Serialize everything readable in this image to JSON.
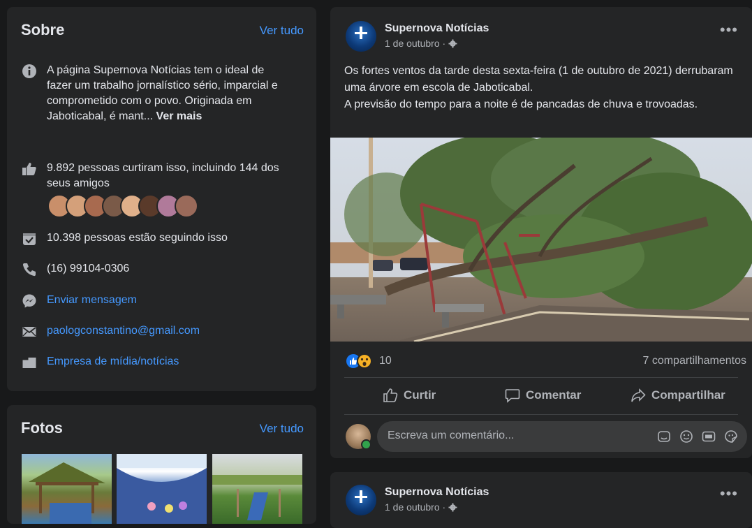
{
  "about": {
    "title": "Sobre",
    "see_all": "Ver tudo",
    "description": "A página Supernova Notícias tem o ideal de fazer um trabalho jornalístico sério, imparcial e comprometido com o povo. Originada em Jaboticabal, é mant...",
    "see_more": "Ver mais",
    "likes": "9.892 pessoas curtiram isso, incluindo 144 dos seus amigos",
    "followers": "10.398 pessoas estão seguindo isso",
    "phone": "(16) 99104-0306",
    "message": "Enviar mensagem",
    "email": "paologconstantino@gmail.com",
    "category": "Empresa de mídia/notícias",
    "icons": [
      "info-icon",
      "thumbs-up-icon",
      "follow-icon",
      "phone-icon",
      "messenger-icon",
      "mail-icon",
      "category-icon"
    ],
    "friend_avatar_colors": [
      "#c98f6a",
      "#d4a07a",
      "#a86a4f",
      "#7a5a48",
      "#e0b08a",
      "#5a3a2a",
      "#b07a9a",
      "#9a6a5a"
    ]
  },
  "photos": {
    "title": "Fotos",
    "see_all": "Ver tudo"
  },
  "post": {
    "page_name": "Supernova Notícias",
    "date": "1 de outubro ·",
    "text_line1": "Os fortes ventos da tarde desta sexta-feira (1 de outubro de 2021) derrubaram uma árvore em escola de Jaboticabal.",
    "text_line2": "A previsão do tempo para a noite é de pancadas de chuva e trovoadas.",
    "reaction_count": "10",
    "shares": "7 compartilhamentos",
    "like_label": "Curtir",
    "comment_label": "Comentar",
    "share_label": "Compartilhar",
    "comment_placeholder": "Escreva um comentário..."
  },
  "post2": {
    "page_name": "Supernova Notícias",
    "date": "1 de outubro ·"
  },
  "colors": {
    "background": "#18191a",
    "card": "#242526",
    "link": "#4599ff",
    "text": "#e4e6eb",
    "secondary": "#b0b3b8"
  }
}
